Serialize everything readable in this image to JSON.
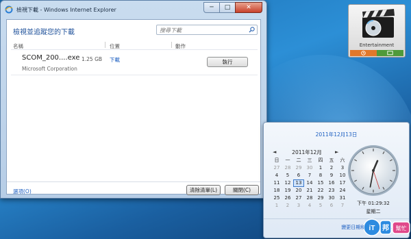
{
  "window": {
    "title": "檢視下載 - Windows Internet Explorer",
    "minimize": "─",
    "maximize": "□",
    "close": "✕"
  },
  "downloads": {
    "heading": "檢視並追蹤您的下載",
    "search_placeholder": "搜尋下載",
    "columns": {
      "name": "名稱",
      "location": "位置",
      "action": "動作"
    },
    "item": {
      "name": "SCOM_200....exe",
      "size": "1.25 GB",
      "publisher": "Microsoft Corporation",
      "location": "下載",
      "action": "執行"
    },
    "options_link": "選項(O)",
    "clear_list": "清除清單(L)",
    "close": "關閉(C)"
  },
  "gadget": {
    "label": "Entertainment"
  },
  "calendar": {
    "long_date": "2011年12月13日",
    "month_title": "2011年12月",
    "prev": "◄",
    "next": "►",
    "weekdays": [
      "日",
      "一",
      "二",
      "三",
      "四",
      "五",
      "六"
    ],
    "weeks": [
      [
        "27",
        "28",
        "29",
        "30",
        "1",
        "2",
        "3"
      ],
      [
        "4",
        "5",
        "6",
        "7",
        "8",
        "9",
        "10"
      ],
      [
        "11",
        "12",
        "13",
        "14",
        "15",
        "16",
        "17"
      ],
      [
        "18",
        "19",
        "20",
        "21",
        "22",
        "23",
        "24"
      ],
      [
        "25",
        "26",
        "27",
        "28",
        "29",
        "30",
        "31"
      ],
      [
        "1",
        "2",
        "3",
        "4",
        "5",
        "6",
        "7"
      ]
    ],
    "today": "13",
    "time": "下午 01:29:32",
    "weekday": "星期二",
    "settings_link": "變更日期和時間設定值..."
  },
  "watermark": {
    "text": "iT邦",
    "sub": "幫忙"
  },
  "colors": {
    "link": "#1a5dc0",
    "desktop": "#1b6fb3",
    "close_button": "#c8402a"
  }
}
